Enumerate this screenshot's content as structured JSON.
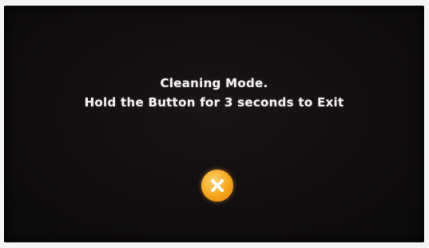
{
  "screen": {
    "line1": "Cleaning Mode.",
    "line2": "Hold the Button for 3 seconds to Exit"
  },
  "exit_button": {
    "icon": "close-icon",
    "color": "#f6a51c"
  }
}
